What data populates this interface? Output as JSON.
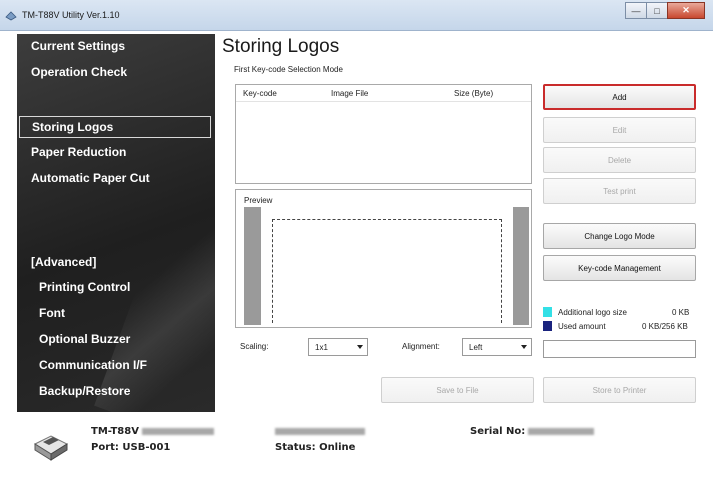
{
  "window": {
    "title": "TM-T88V Utility Ver.1.10",
    "controls": {
      "minimize": "—",
      "maximize": "□",
      "close": "✕"
    }
  },
  "sidebar": {
    "items": [
      {
        "label": "Current Settings"
      },
      {
        "label": "Operation Check"
      },
      {
        "label": "Storing Logos",
        "selected": true
      },
      {
        "label": "Paper Reduction"
      },
      {
        "label": "Automatic Paper Cut"
      },
      {
        "label": "[Advanced]"
      },
      {
        "label": "Printing Control"
      },
      {
        "label": "Font"
      },
      {
        "label": "Optional Buzzer"
      },
      {
        "label": "Communication I/F"
      },
      {
        "label": "Backup/Restore"
      }
    ]
  },
  "main": {
    "title": "Storing Logos",
    "mode_label": "First Key-code Selection Mode",
    "table": {
      "columns": [
        "Key-code",
        "Image File",
        "Size (Byte)"
      ],
      "rows": []
    },
    "preview_label": "Preview",
    "scaling": {
      "label": "Scaling:",
      "value": "1x1"
    },
    "alignment": {
      "label": "Alignment:",
      "value": "Left"
    },
    "buttons": {
      "add": "Add",
      "edit": "Edit",
      "delete": "Delete",
      "test_print": "Test print",
      "change_logo_mode": "Change Logo Mode",
      "keycode_management": "Key-code Management",
      "save_to_file": "Save to File",
      "store_to_printer": "Store to Printer"
    },
    "usage": {
      "additional_label": "Additional logo size",
      "additional_value": "0 KB",
      "used_label": "Used amount",
      "used_value": "0 KB/256 KB",
      "additional_color": "#33e0e6",
      "used_color": "#1a237e"
    }
  },
  "footer": {
    "model": "TM-T88V",
    "port": "Port: USB-001",
    "status": "Status: Online",
    "serial_label": "Serial No:"
  }
}
